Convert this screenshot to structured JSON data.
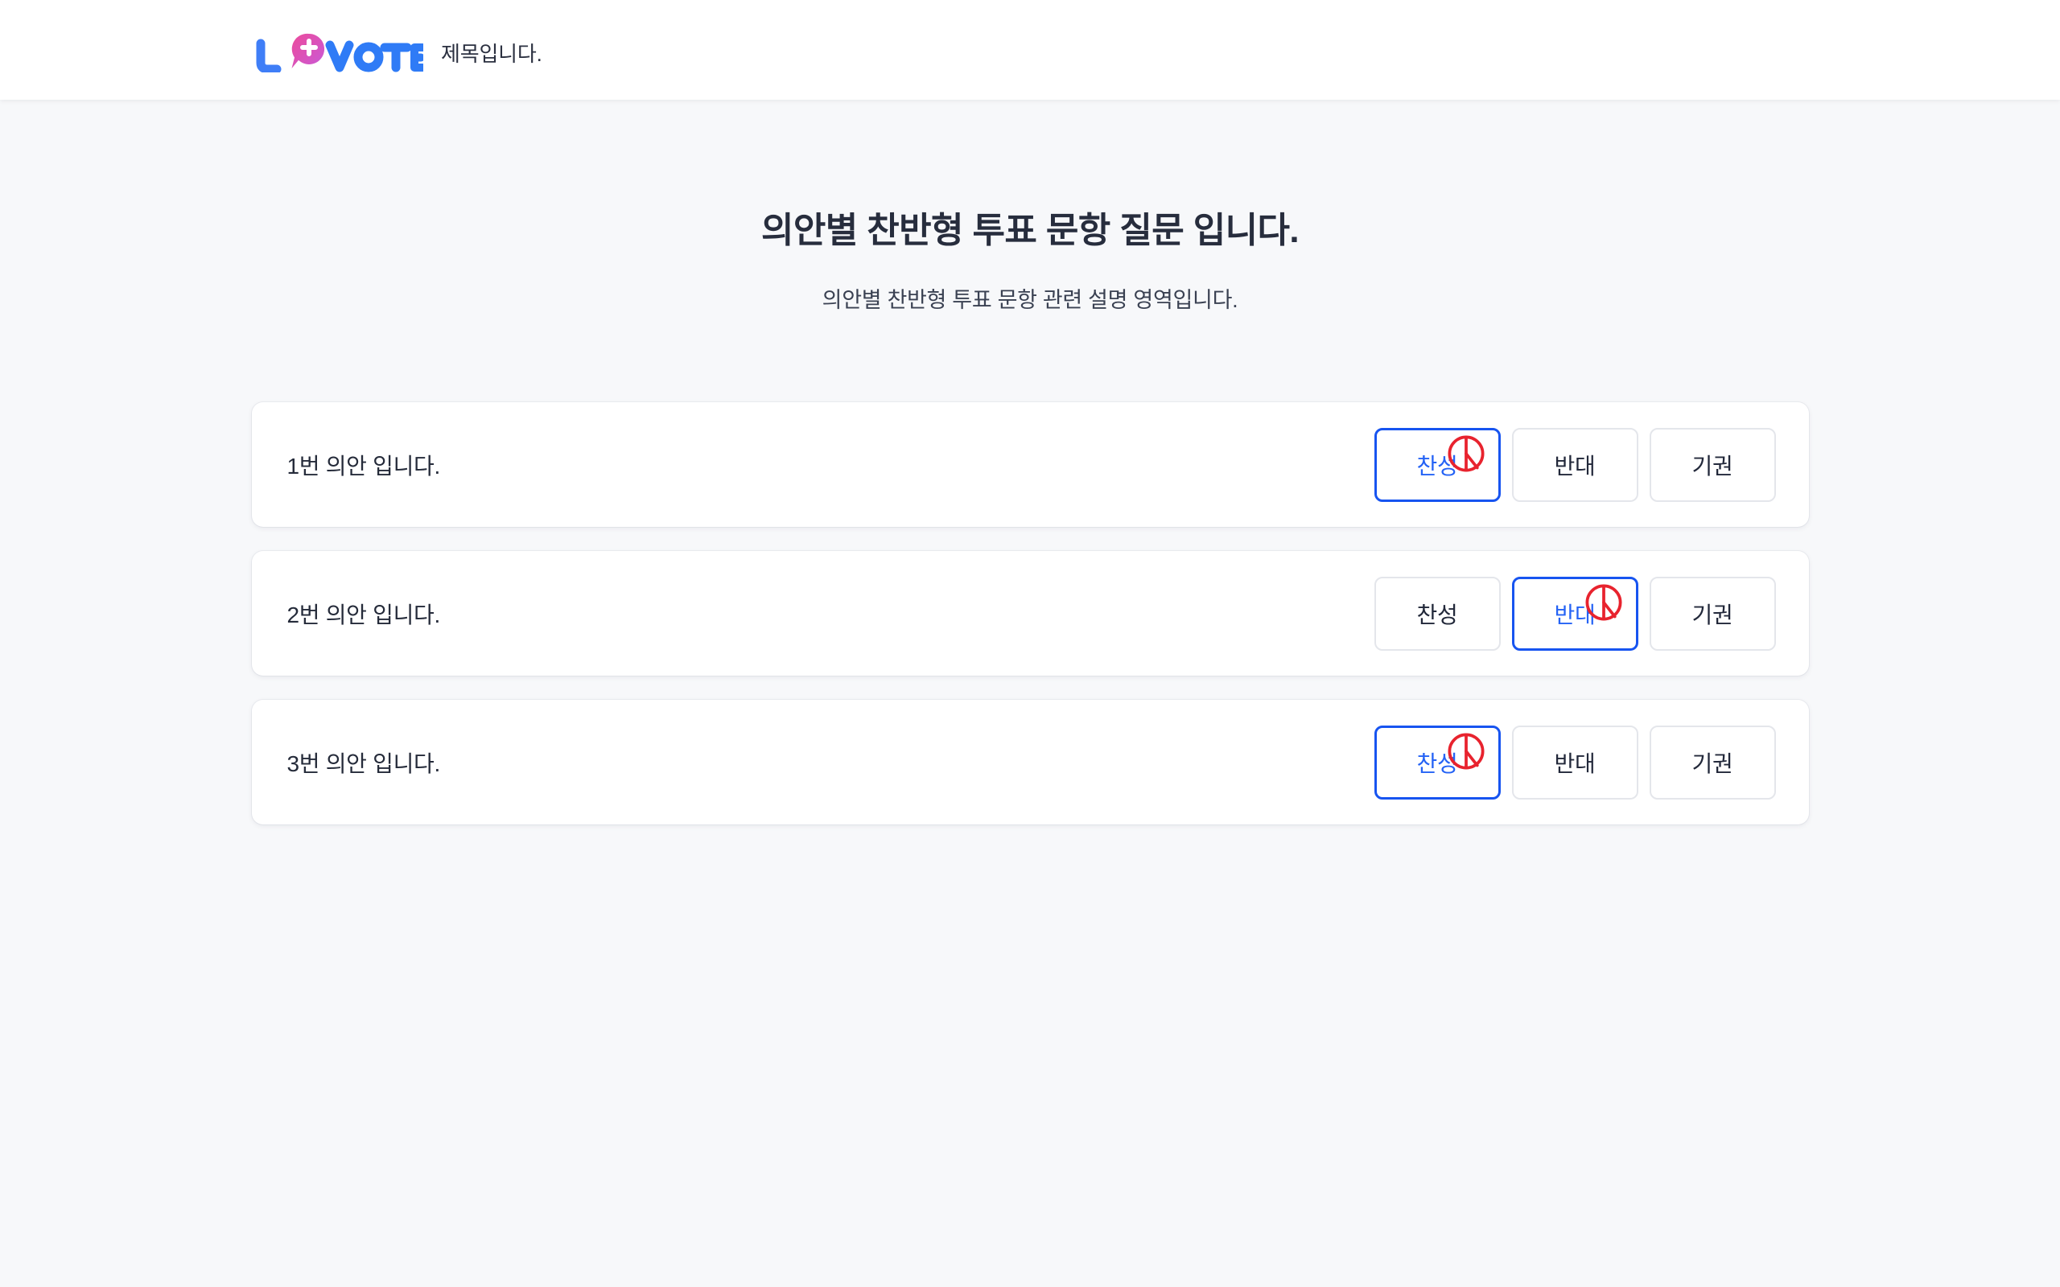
{
  "header": {
    "logo": {
      "icon_name": "u-vote-logo",
      "mark_text": "VOTE",
      "colors": {
        "blue": "#2f7bf6",
        "pink": "#ec4b9b",
        "magenta": "#e0449c"
      }
    },
    "title": "제목입니다."
  },
  "main": {
    "title": "의안별 찬반형 투표 문항 질문 입니다.",
    "description": "의안별 찬반형 투표 문항 관련 설명 영역입니다.",
    "choice_labels": {
      "agree": "찬성",
      "oppose": "반대",
      "abstain": "기권"
    },
    "seal_icon_name": "vote-seal-icon",
    "agendas": [
      {
        "label": "1번 의안 입니다.",
        "selected": "agree",
        "choices": [
          {
            "label": "찬성",
            "value": "agree",
            "selected": true
          },
          {
            "label": "반대",
            "value": "oppose",
            "selected": false
          },
          {
            "label": "기권",
            "value": "abstain",
            "selected": false
          }
        ]
      },
      {
        "label": "2번 의안 입니다.",
        "selected": "oppose",
        "choices": [
          {
            "label": "찬성",
            "value": "agree",
            "selected": false
          },
          {
            "label": "반대",
            "value": "oppose",
            "selected": true
          },
          {
            "label": "기권",
            "value": "abstain",
            "selected": false
          }
        ]
      },
      {
        "label": "3번 의안 입니다.",
        "selected": "agree",
        "choices": [
          {
            "label": "찬성",
            "value": "agree",
            "selected": true
          },
          {
            "label": "반대",
            "value": "oppose",
            "selected": false
          },
          {
            "label": "기권",
            "value": "abstain",
            "selected": false
          }
        ]
      }
    ]
  },
  "colors": {
    "page_background": "#f7f8fa",
    "card_background": "#ffffff",
    "selected_border": "#1754f0",
    "selected_text": "#2563f5",
    "idle_border": "#e4e6eb",
    "text_primary": "#252b3a",
    "seal_red": "#e8232e"
  }
}
